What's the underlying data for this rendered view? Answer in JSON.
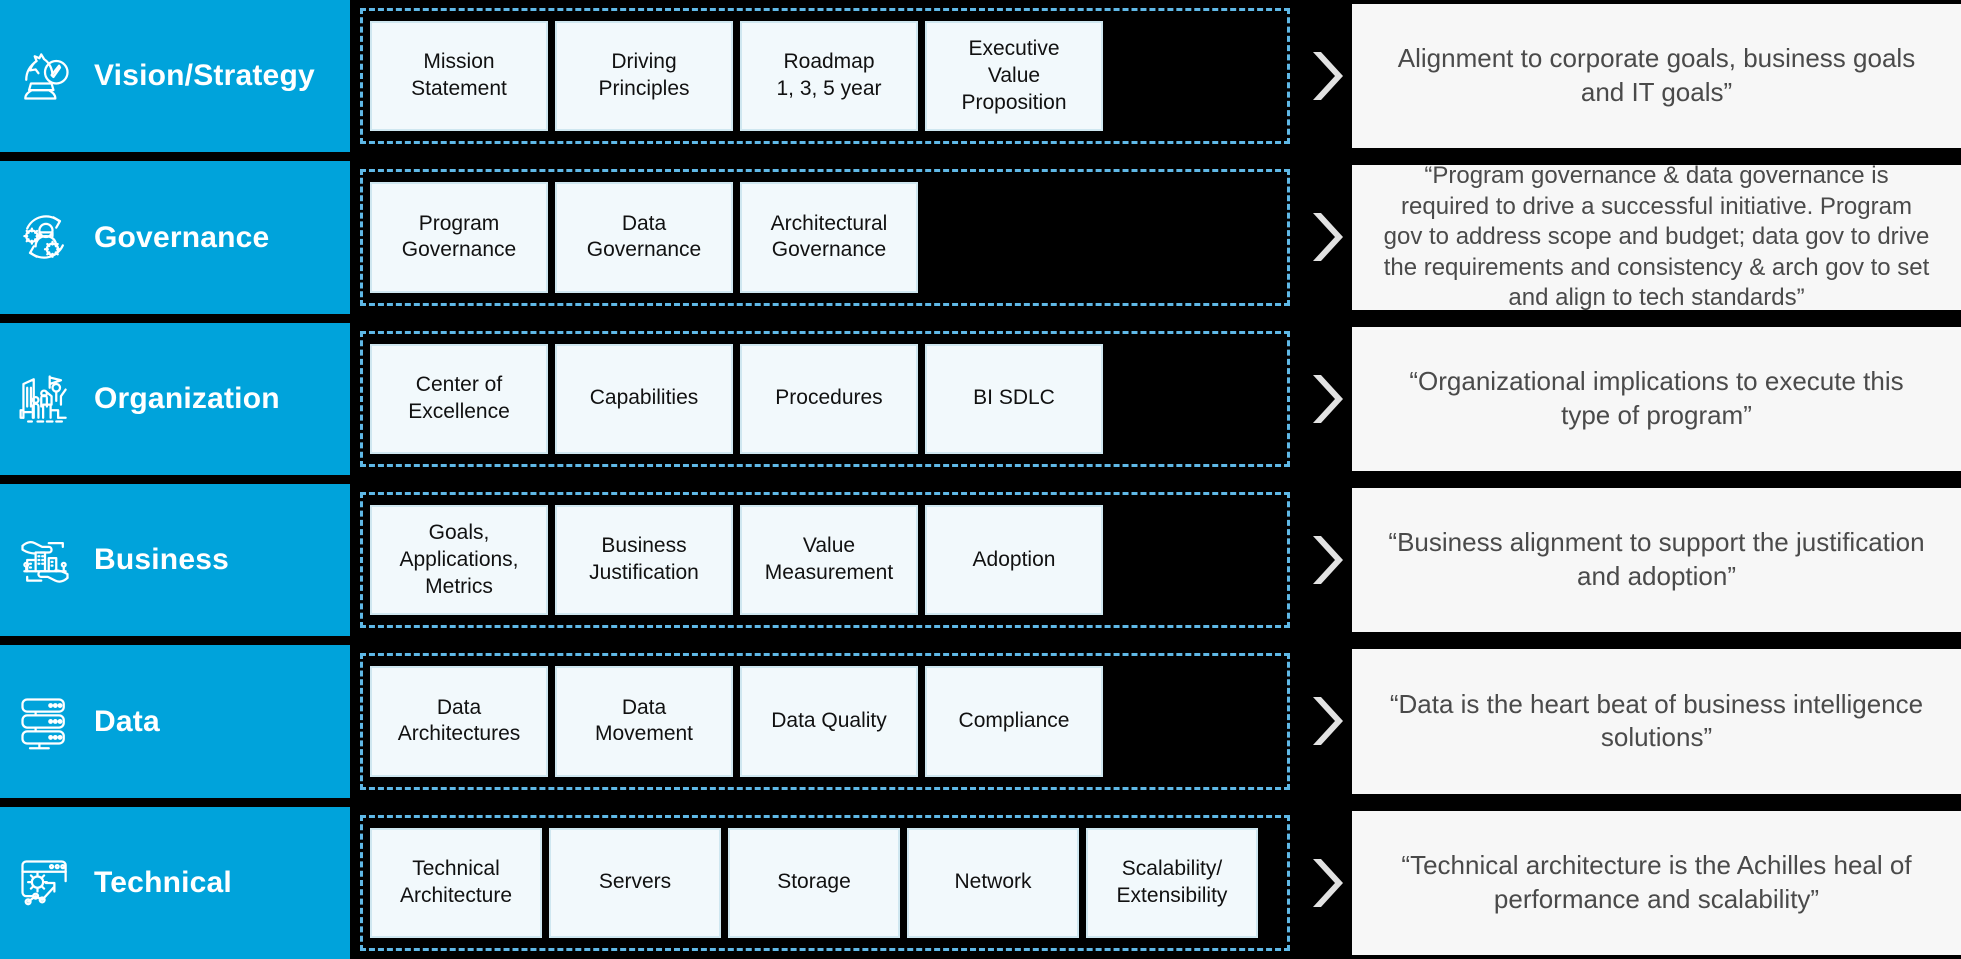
{
  "colors": {
    "pillar_bg": "#00A3DB",
    "pillar_text": "#FFFFFF",
    "canvas": "#000000",
    "dashed_border": "#5FB8E6",
    "cell_bg": "#F2F9FC",
    "cell_border": "#CFE7F0",
    "cell_text": "#111111",
    "note_bg": "#F7F7F7",
    "note_text": "#4A4A4A",
    "chevron": "#E2E2E2"
  },
  "rows": [
    {
      "id": "vision-strategy",
      "icon": "chess-knight-compass-icon",
      "label": "Vision/Strategy",
      "cells": [
        "Mission\nStatement",
        "Driving\nPrinciples",
        "Roadmap\n1, 3, 5 year",
        "Executive\nValue\nProposition"
      ],
      "note": "Alignment to corporate goals, business goals and IT goals”"
    },
    {
      "id": "governance",
      "icon": "governance-cycle-icon",
      "label": "Governance",
      "cells": [
        "Program\nGovernance",
        "Data\nGovernance",
        "Architectural\nGovernance"
      ],
      "note": "“Program governance & data governance is required to drive a successful initiative.  Program gov to address scope and budget; data gov to drive the requirements and consistency & arch gov to set and align to tech standards”"
    },
    {
      "id": "organization",
      "icon": "organization-building-icon",
      "label": "Organization",
      "cells": [
        "Center of\nExcellence",
        "Capabilities",
        "Procedures",
        "BI SDLC"
      ],
      "note": "“Organizational implications to execute this type of program”"
    },
    {
      "id": "business",
      "icon": "business-hands-buildings-icon",
      "label": "Business",
      "cells": [
        "Goals,\nApplications,\nMetrics",
        "Business\nJustification",
        "Value\nMeasurement",
        "Adoption"
      ],
      "note": "“Business alignment to support the justification and adoption”"
    },
    {
      "id": "data",
      "icon": "database-server-icon",
      "label": "Data",
      "cells": [
        "Data\nArchitectures",
        "Data\nMovement",
        "Data Quality",
        "Compliance"
      ],
      "note": "“Data is the heart beat of business intelligence solutions”"
    },
    {
      "id": "technical",
      "icon": "browser-gear-chart-icon",
      "label": "Technical",
      "cells": [
        "Technical\nArchitecture",
        "Servers",
        "Storage",
        "Network",
        "Scalability/\nExtensibility"
      ],
      "note": "“Technical architecture is the Achilles heal of performance and scalability”"
    }
  ]
}
